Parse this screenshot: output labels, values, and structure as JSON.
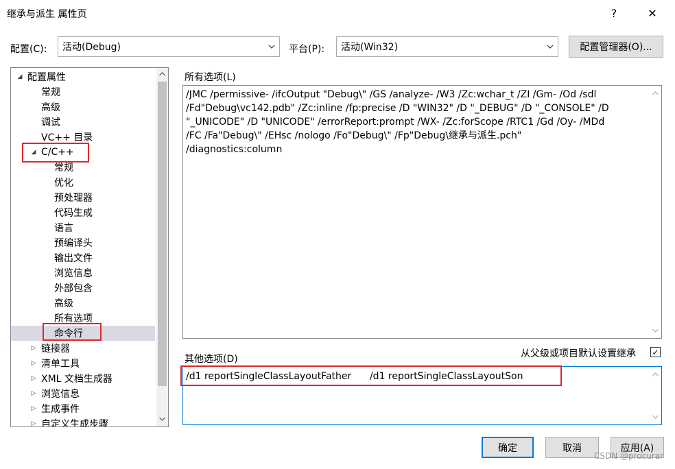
{
  "window": {
    "title": "继承与派生 属性页",
    "help": "?",
    "close": "✕"
  },
  "config": {
    "label": "配置(C):",
    "value": "活动(Debug)",
    "platform_label": "平台(P):",
    "platform_value": "活动(Win32)",
    "manager_button": "配置管理器(O)..."
  },
  "tree": {
    "root": "配置属性",
    "items": [
      "常规",
      "高级",
      "调试",
      "VC++ 目录",
      "C/C++",
      "常规",
      "优化",
      "预处理器",
      "代码生成",
      "语言",
      "预编译头",
      "输出文件",
      "浏览信息",
      "外部包含",
      "高级",
      "所有选项",
      "命令行",
      "链接器",
      "清单工具",
      "XML 文档生成器",
      "浏览信息",
      "生成事件",
      "自定义生成步骤"
    ],
    "collapse_arrow": "◢",
    "expand_arrow": "▷"
  },
  "all_options": {
    "label": "所有选项(L)",
    "lines": [
      "/JMC /permissive- /ifcOutput \"Debug\\\" /GS /analyze- /W3 /Zc:wchar_t /ZI /Gm- /Od /sdl",
      "/Fd\"Debug\\vc142.pdb\" /Zc:inline /fp:precise /D \"WIN32\" /D \"_DEBUG\" /D \"_CONSOLE\" /D",
      "\"_UNICODE\" /D \"UNICODE\" /errorReport:prompt /WX- /Zc:forScope /RTC1 /Gd /Oy- /MDd",
      "/FC /Fa\"Debug\\\" /EHsc /nologo /Fo\"Debug\\\" /Fp\"Debug\\继承与派生.pch\"",
      "/diagnostics:column"
    ]
  },
  "other_options": {
    "label": "其他选项(D)",
    "inherit_label": "从父级或项目默认设置继承",
    "inherit_checked": "✓",
    "value": "/d1 reportSingleClassLayoutFather      /d1 reportSingleClassLayoutSon"
  },
  "buttons": {
    "ok": "确定",
    "cancel": "取消",
    "apply": "应用(A)"
  },
  "watermark": "CSDN @procurar"
}
